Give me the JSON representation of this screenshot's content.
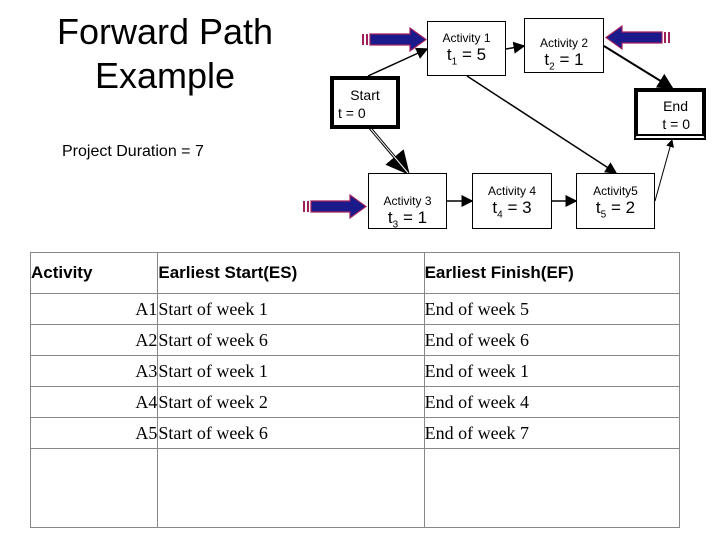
{
  "title": [
    "Forward Path",
    "Example"
  ],
  "project_duration": "Project Duration = 7",
  "nodes": {
    "start": {
      "label": "Start",
      "time": "t = 0"
    },
    "end": {
      "label": "End",
      "time": "t = 0"
    },
    "a1": {
      "label": "Activity 1",
      "var": "t",
      "sub": "1",
      "value": "= 5"
    },
    "a2": {
      "label": "Activity 2",
      "var": "t",
      "sub": "2",
      "value": "= 1"
    },
    "a3": {
      "label": "Activity 3",
      "var": "t",
      "sub": "3",
      "value": "= 1"
    },
    "a4": {
      "label": "Activity 4",
      "var": "t",
      "sub": "4",
      "value": "= 3"
    },
    "a5": {
      "label": "Activity5",
      "var": "t",
      "sub": "5",
      "value": "= 2"
    }
  },
  "edges": [
    [
      "start",
      "a1"
    ],
    [
      "a1",
      "a2"
    ],
    [
      "a2",
      "end"
    ],
    [
      "start",
      "a3"
    ],
    [
      "a3",
      "a4"
    ],
    [
      "a4",
      "a5"
    ],
    [
      "a5",
      "end"
    ],
    [
      "a1",
      "a5"
    ]
  ],
  "highlight_arrows": {
    "color_fill": "#1a1a8c",
    "color_outline": "#a0205a",
    "targets": [
      "a1",
      "a2",
      "a3"
    ]
  },
  "table": {
    "headers": [
      "Activity",
      "Earliest Start(ES)",
      "Earliest Finish(EF)"
    ],
    "rows": [
      [
        "A1",
        "Start of week 1",
        "End of week 5"
      ],
      [
        "A2",
        "Start of week 6",
        "End of week 6"
      ],
      [
        "A3",
        "Start of week 1",
        "End of week 1"
      ],
      [
        "A4",
        "Start of week 2",
        "End of week 4"
      ],
      [
        "A5",
        "Start of week 6",
        "End of week 7"
      ]
    ]
  }
}
